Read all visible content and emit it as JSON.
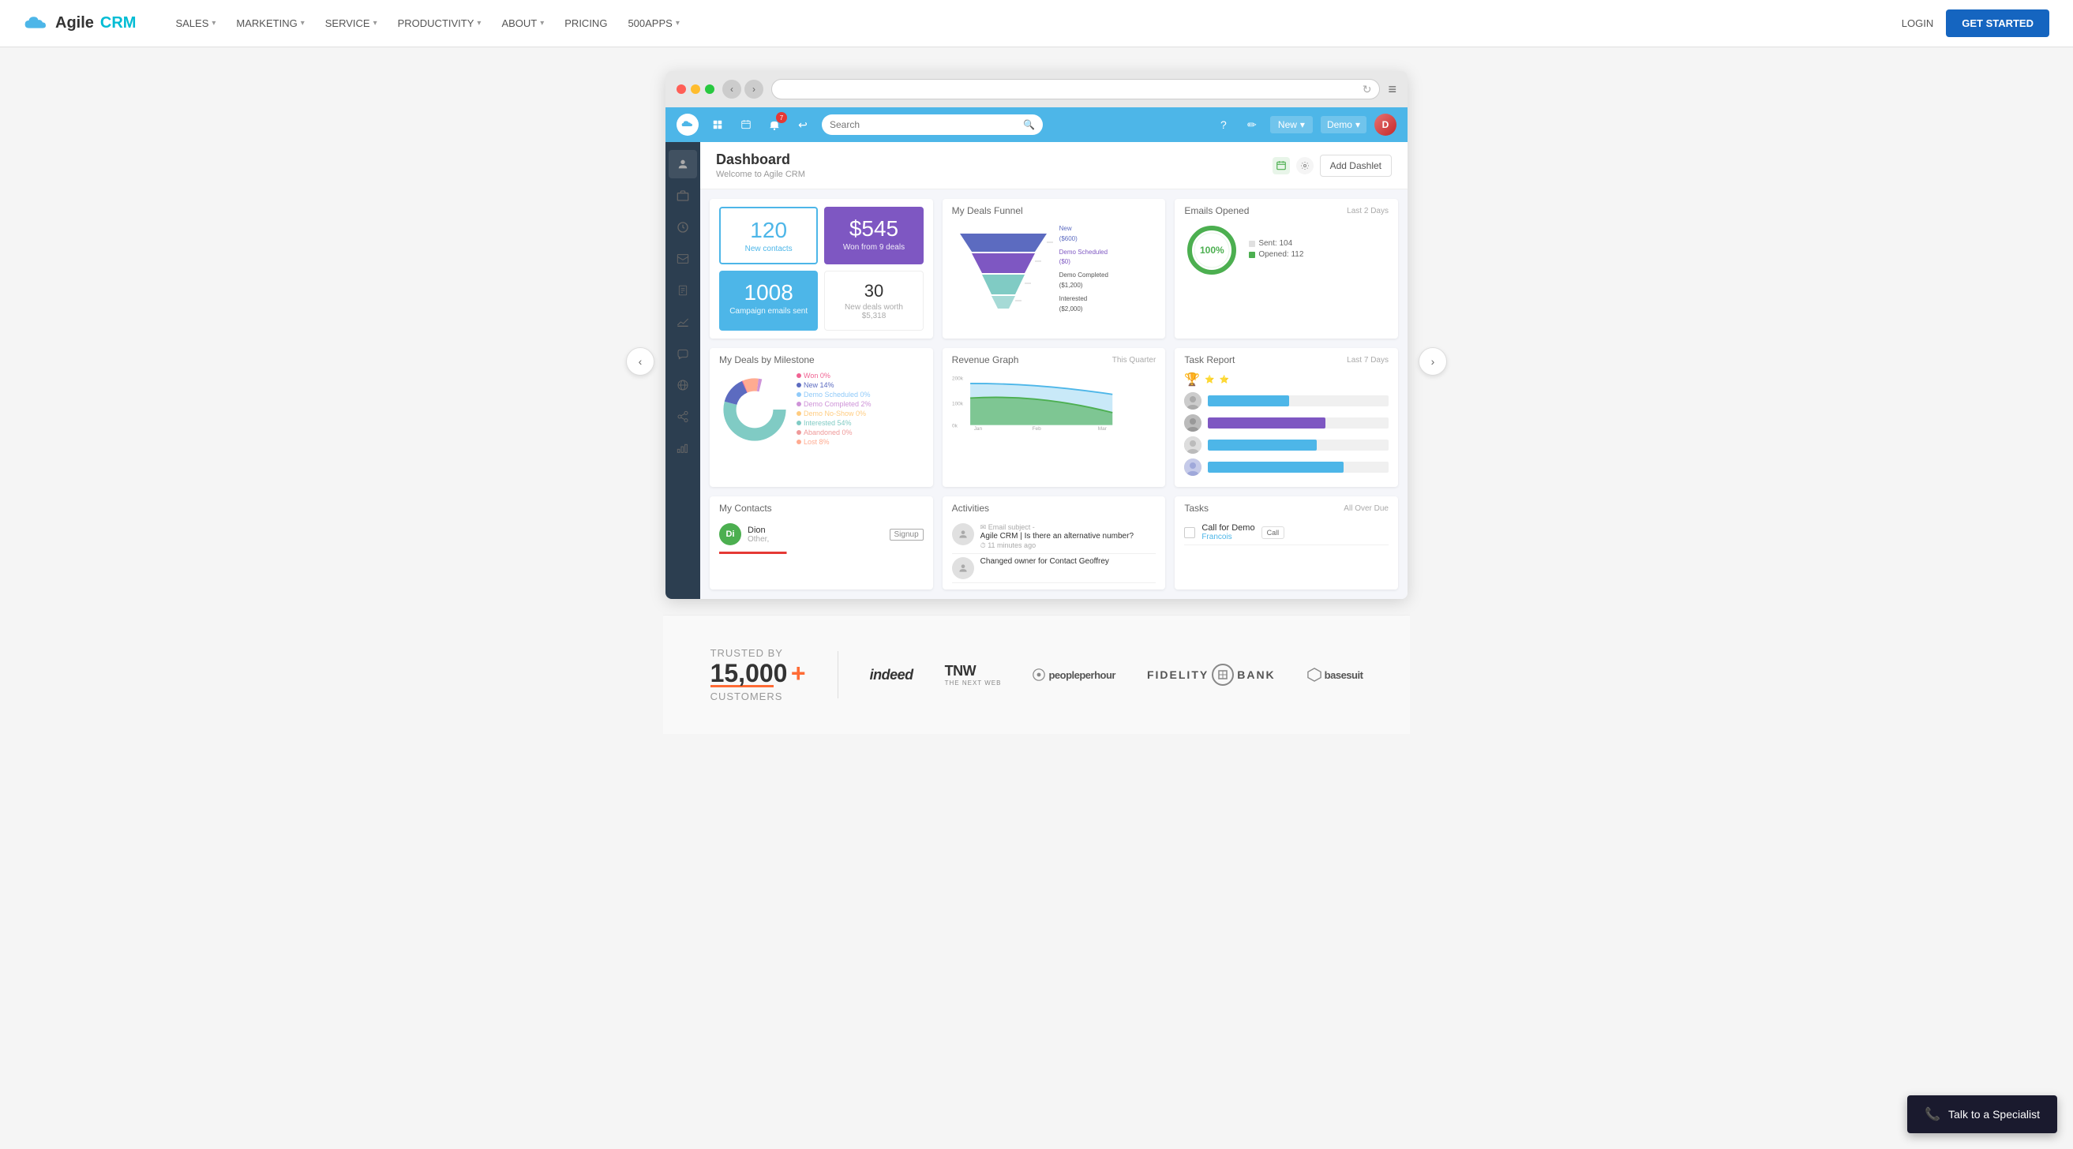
{
  "topnav": {
    "logo_agile": "Agile",
    "logo_crm": "CRM",
    "nav_items": [
      {
        "label": "SALES",
        "has_dropdown": true
      },
      {
        "label": "MARKETING",
        "has_dropdown": true
      },
      {
        "label": "SERVICE",
        "has_dropdown": true
      },
      {
        "label": "PRODUCTIVITY",
        "has_dropdown": true
      },
      {
        "label": "ABOUT",
        "has_dropdown": true
      },
      {
        "label": "PRICING",
        "has_dropdown": false
      },
      {
        "label": "500APPS",
        "has_dropdown": true
      }
    ],
    "login_label": "LOGIN",
    "get_started_label": "GET STARTED"
  },
  "browser": {
    "url_placeholder": "",
    "menu_icon": "≡"
  },
  "crm_topbar": {
    "search_placeholder": "Search",
    "new_label": "New",
    "demo_label": "Demo"
  },
  "dashboard": {
    "title": "Dashboard",
    "subtitle": "Welcome to Agile CRM",
    "add_dashlet_label": "Add Dashlet"
  },
  "stats": {
    "new_contacts_number": "120",
    "new_contacts_label": "New contacts",
    "won_amount": "$545",
    "won_label": "Won from 9 deals",
    "emails_sent_number": "1008",
    "emails_sent_label": "Campaign emails sent",
    "new_deals_number": "30",
    "new_deals_label": "New deals worth $5,318"
  },
  "deals_funnel": {
    "title": "My Deals Funnel",
    "legend": [
      {
        "label": "New ($600)",
        "color": "#5c6bc0"
      },
      {
        "label": "Demo Scheduled ($0)",
        "color": "#7e57c2"
      },
      {
        "label": "Demo Completed ($1,200)",
        "color": "#80cbc4"
      },
      {
        "label": "Interested ($2,000)",
        "color": "#80cbc4"
      }
    ]
  },
  "emails_opened": {
    "title": "Emails Opened",
    "subtitle": "Last 2 Days",
    "percentage": "100%",
    "sent": "Sent: 104",
    "opened": "Opened: 112"
  },
  "milestone": {
    "title": "My Deals by Milestone",
    "segments": [
      {
        "label": "Won 0%",
        "color": "#f06292"
      },
      {
        "label": "New 14%",
        "color": "#5c6bc0"
      },
      {
        "label": "Demo Scheduled 0%",
        "color": "#90caf9"
      },
      {
        "label": "Demo Completed 2%",
        "color": "#ce93d8"
      },
      {
        "label": "Demo No-Show 0%",
        "color": "#ffcc80"
      },
      {
        "label": "Interested 54%",
        "color": "#80cbc4"
      },
      {
        "label": "Abandoned 0%",
        "color": "#ef9a9a"
      },
      {
        "label": "Lost 8%",
        "color": "#ffab91"
      }
    ]
  },
  "revenue": {
    "title": "Revenue Graph",
    "subtitle": "This Quarter",
    "y_max": "200k",
    "y_mid": "100k",
    "y_min": "0k",
    "x_labels": [
      "Jan",
      "Feb",
      "Mar"
    ]
  },
  "task_report": {
    "title": "Task Report",
    "subtitle": "Last 7 Days",
    "rows": [
      {
        "color": "#4db6e8",
        "width": 45
      },
      {
        "color": "#7e57c2",
        "width": 65
      },
      {
        "color": "#4db6e8",
        "width": 60
      },
      {
        "color": "#4db6e8",
        "width": 75
      }
    ]
  },
  "my_contacts": {
    "title": "My Contacts",
    "contacts": [
      {
        "initials": "Di",
        "name": "Dion",
        "type": "Other,",
        "tag": "Signup"
      }
    ]
  },
  "activities": {
    "title": "Activities",
    "items": [
      {
        "icon": "✉",
        "subject": "Agile CRM | Is there an alternative number?",
        "time": "11 minutes ago"
      },
      {
        "icon": "↻",
        "subject": "Changed owner for Contact Geoffrey",
        "time": ""
      }
    ]
  },
  "tasks": {
    "title": "Tasks",
    "subtitle": "All Over Due",
    "items": [
      {
        "name": "Call for Demo",
        "person": "Francois",
        "action": "Call"
      }
    ]
  },
  "trusted": {
    "label": "TRUSTED BY",
    "number": "15,000+",
    "customers": "CUSTOMERS"
  },
  "partners": [
    {
      "name": "indeed",
      "display": "indeed"
    },
    {
      "name": "TNW",
      "display": "TNW\nTHE NEXT WEB"
    },
    {
      "name": "peopleperhour",
      "display": "● peopleperhour"
    },
    {
      "name": "fidelity",
      "display": "FIDELITY ⊟ BANK"
    },
    {
      "name": "basesuit",
      "display": "⬡ basesuit"
    }
  ],
  "specialist": {
    "label": "Talk to a Specialist",
    "phone_icon": "📞"
  }
}
